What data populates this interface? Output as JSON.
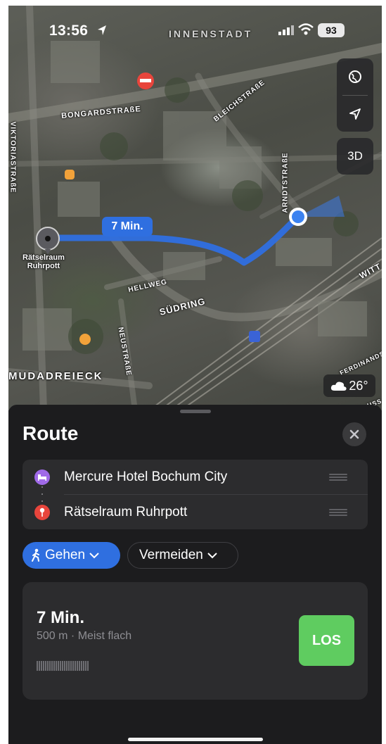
{
  "status_bar": {
    "time": "13:56",
    "battery": "93"
  },
  "map": {
    "streets": {
      "innenstadt": "INNENSTADT",
      "bongardstrasse": "BONGARDSTRAßE",
      "bleichstrasse": "BLEICHSTRAßE",
      "arndtstrasse": "ARNDTSTRAßE",
      "viktoriastrasse": "VIKTORIASTRAßE",
      "hellweg": "HELLWEG",
      "suedring": "SÜDRING",
      "neustrasse": "NEUSTRAßE",
      "witten": "WITT",
      "bermudadreieck": "MUDADREIECK",
      "ferdinandstr": "FERDINANDSTR",
      "strasse_edge": "USS"
    },
    "route_time_label": "7 Min.",
    "destination_label_line1": "Rätselraum",
    "destination_label_line2": "Ruhrpott",
    "controls": {
      "globe_icon": "globe-icon",
      "locate_icon": "location-arrow-icon",
      "view_3d": "3D"
    },
    "weather": {
      "icon": "cloud-icon",
      "temperature": "26°"
    },
    "route_color": "#2f6fe0"
  },
  "sheet": {
    "title": "Route",
    "stops": [
      {
        "label": "Mercure Hotel Bochum City",
        "icon": "bed-icon",
        "color": "#a06ae8"
      },
      {
        "label": "Rätselraum Ruhrpott",
        "icon": "pin-icon",
        "color": "#e8453c"
      }
    ],
    "mode_pill": {
      "label": "Gehen",
      "icon": "walk-icon"
    },
    "avoid_pill": {
      "label": "Vermeiden"
    },
    "route_card": {
      "duration": "7 Min.",
      "details": "500 m · Meist flach",
      "go_label": "LOS"
    }
  }
}
